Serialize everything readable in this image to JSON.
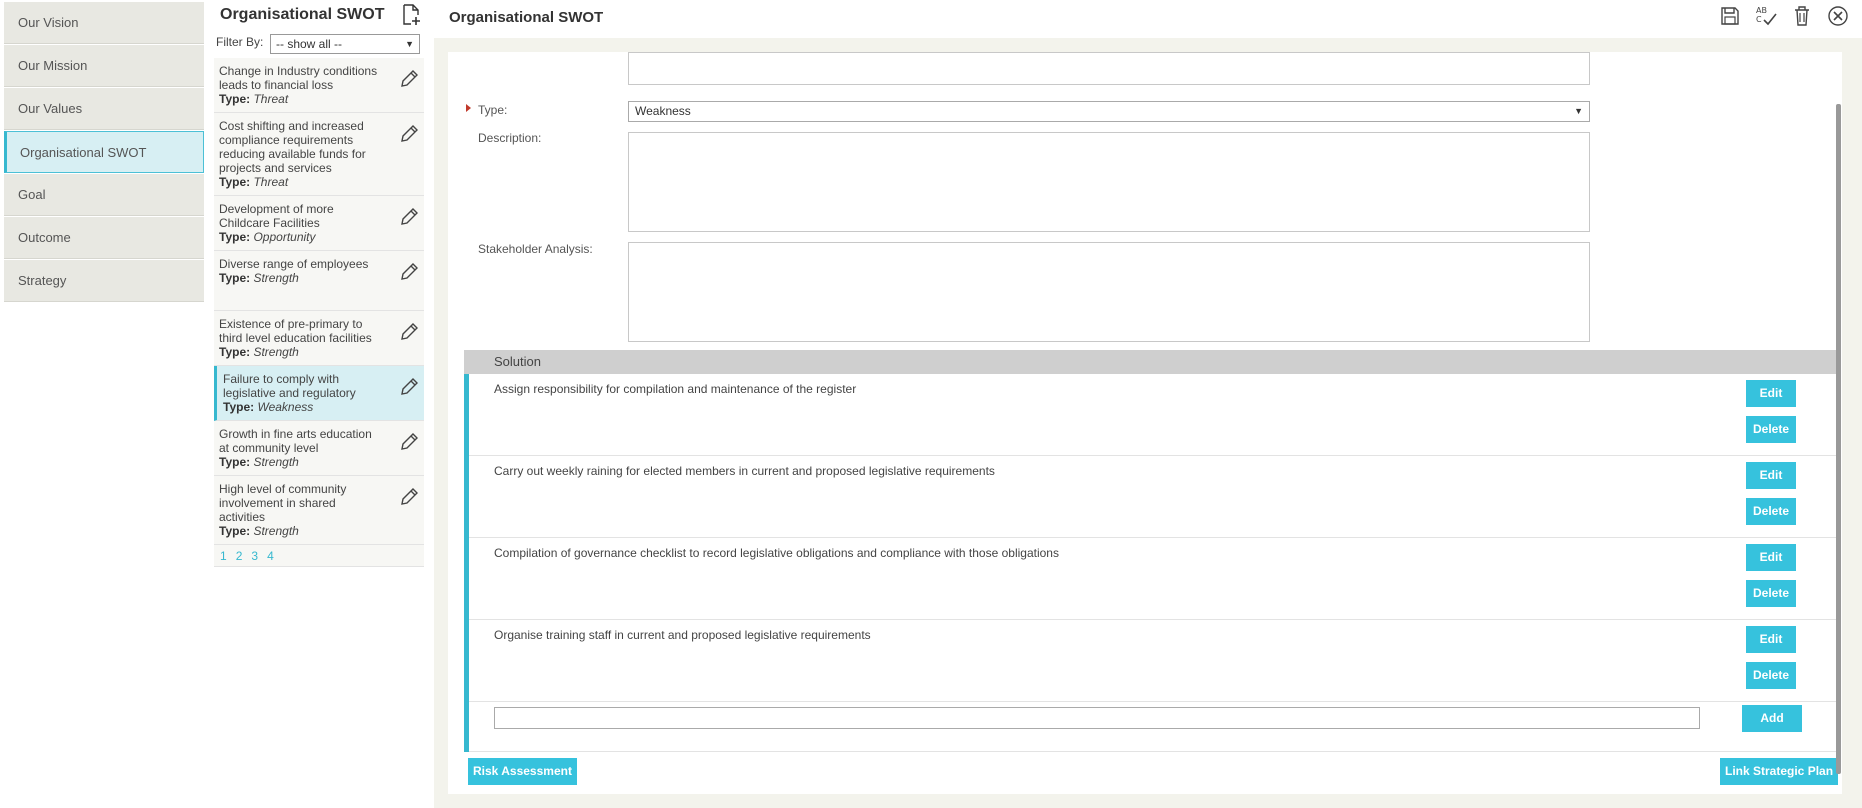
{
  "nav": {
    "items": [
      {
        "label": "Our Vision"
      },
      {
        "label": "Our Mission"
      },
      {
        "label": "Our Values"
      },
      {
        "label": "Organisational SWOT"
      },
      {
        "label": "Goal"
      },
      {
        "label": "Outcome"
      },
      {
        "label": "Strategy"
      }
    ],
    "active_index": 3
  },
  "list": {
    "title": "Organisational SWOT",
    "filter_label": "Filter By:",
    "filter_value": "-- show all --",
    "type_prefix": "Type:",
    "items": [
      {
        "text": "Change in Industry conditions leads to financial loss",
        "type": "Threat"
      },
      {
        "text": "Cost shifting and increased compliance requirements reducing available funds for projects and services",
        "type": "Threat"
      },
      {
        "text": "Development of more Childcare Facilities",
        "type": "Opportunity"
      },
      {
        "text": "Diverse range of employees",
        "type": "Strength"
      },
      {
        "text": "Existence of pre-primary to third level education facilities",
        "type": "Strength"
      },
      {
        "text": "Failure to comply with legislative and regulatory",
        "type": "Weakness"
      },
      {
        "text": "Growth in fine arts education at community level",
        "type": "Strength"
      },
      {
        "text": "High level of community involvement in shared activities",
        "type": "Strength"
      }
    ],
    "pages": [
      "1",
      "2",
      "3",
      "4"
    ]
  },
  "main": {
    "title": "Organisational SWOT",
    "type_label": "Type:",
    "type_value": "Weakness",
    "description_label": "Description:",
    "stakeholder_label": "Stakeholder Analysis:",
    "solution_header": "Solution",
    "solutions": [
      {
        "text": "Assign responsibility for compilation and maintenance of the register"
      },
      {
        "text": "Carry out weekly raining for elected members in current and proposed legislative requirements"
      },
      {
        "text": "Compilation of governance checklist to record legislative obligations and compliance with those obligations"
      },
      {
        "text": "Organise training staff in current and proposed legislative requirements"
      }
    ],
    "edit_label": "Edit",
    "delete_label": "Delete",
    "add_label": "Add",
    "risk_label": "Risk Assessment",
    "link_label": "Link Strategic Plan"
  },
  "colors": {
    "accent": "#36c2dd",
    "required": "#c0392b"
  }
}
